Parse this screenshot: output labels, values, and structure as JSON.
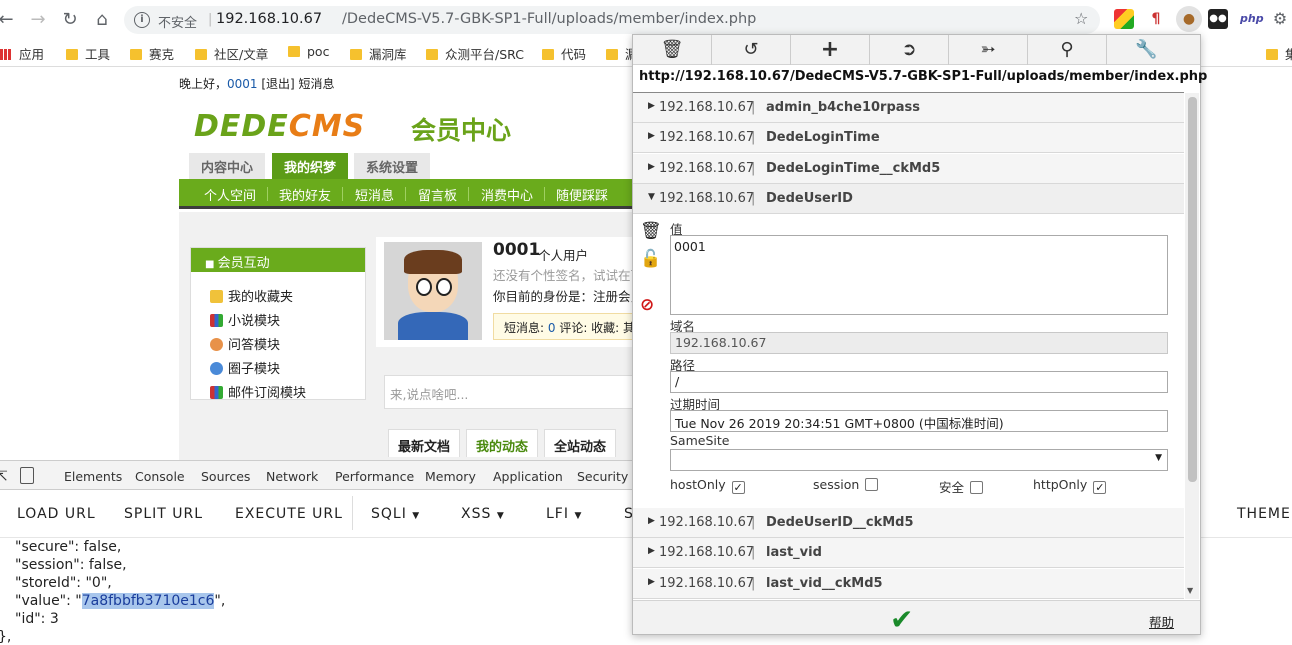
{
  "browser": {
    "insecure_label": "不安全",
    "url_host": "192.168.10.67",
    "url_path": "/DedeCMS-V5.7-GBK-SP1-Full/uploads/member/index.php",
    "ext_php_label": "php",
    "bookmarks": [
      "应用",
      "工具",
      "赛克",
      "社区/文章",
      "poc",
      "漏洞库",
      "众测平台/SRC",
      "代码",
      "漏"
    ],
    "bookmark_right": "集"
  },
  "page": {
    "greeting_prefix": "晚上好，",
    "greeting_user": "0001",
    "greeting_suffix": " [退出] 短消息",
    "logo_main": "DEDE",
    "logo_cms": "CMS",
    "logo_sub": "会员中心",
    "top_tabs": [
      "内容中心",
      "我的织梦",
      "系统设置"
    ],
    "nav": [
      "个人空间",
      "我的好友",
      "短消息",
      "留言板",
      "消费中心",
      "随便踩踩"
    ],
    "left_title": "会员互动",
    "left_items": [
      "我的收藏夹",
      "小说模块",
      "问答模块",
      "圈子模块",
      "邮件订阅模块"
    ],
    "profile_name": "0001",
    "profile_type": "个人用户",
    "profile_sig": "还没有个性签名，试试在下",
    "profile_role": "你目前的身份是：注册会员",
    "profile_stats_prefix": "短消息: ",
    "profile_stats_count": "0",
    "profile_stats_suffix": " 评论: 收藏: 其",
    "say_placeholder": "来,说点啥吧...",
    "sub_tabs": [
      "最新文档",
      "我的动态",
      "全站动态"
    ]
  },
  "devtools": {
    "tabs": [
      "Elements",
      "Console",
      "Sources",
      "Network",
      "Performance",
      "Memory",
      "Application",
      "Security"
    ]
  },
  "hackbar": {
    "buttons": [
      "LOAD URL",
      "SPLIT URL",
      "EXECUTE URL",
      "SQLI",
      "XSS",
      "LFI",
      "S"
    ],
    "theme": "THEME"
  },
  "console": {
    "line1": "\"secure\": false,",
    "line2": "\"session\": false,",
    "line3": "\"storeId\": \"0\",",
    "line4_prefix": "\"value\": \"",
    "line4_value": "7a8fbbfb3710e1c6",
    "line4_suffix": "\",",
    "line5": "\"id\": 3",
    "line6": "},"
  },
  "cookie_editor": {
    "url": "http://192.168.10.67/DedeCMS-V5.7-GBK-SP1-Full/uploads/member/index.php",
    "host": "192.168.10.67",
    "separator": " | ",
    "cookies_before": [
      "admin_b4che10rpass",
      "DedeLoginTime",
      "DedeLoginTime__ckMd5"
    ],
    "open_cookie": "DedeUserID",
    "cookies_after": [
      "DedeUserID__ckMd5",
      "last_vid",
      "last_vid__ckMd5"
    ],
    "value_label": "值",
    "value": "0001",
    "domain_label": "域名",
    "domain": "192.168.10.67",
    "path_label": "路径",
    "path": "/",
    "expires_label": "过期时间",
    "expires": "Tue Nov 26 2019 20:34:51 GMT+0800 (中国标准时间)",
    "samesite_label": "SameSite",
    "samesite_value": "",
    "flags": {
      "hostOnly_label": "hostOnly",
      "hostOnly": true,
      "session_label": "session",
      "session": false,
      "secure_label": "安全",
      "secure": false,
      "httpOnly_label": "httpOnly",
      "httpOnly": true
    },
    "help_label": "帮助"
  },
  "colors": {
    "brand_green": "#6aab1c",
    "logo_orange": "#e87d16",
    "save_green": "#1a8a2a",
    "highlight": "#a8c6ec"
  }
}
